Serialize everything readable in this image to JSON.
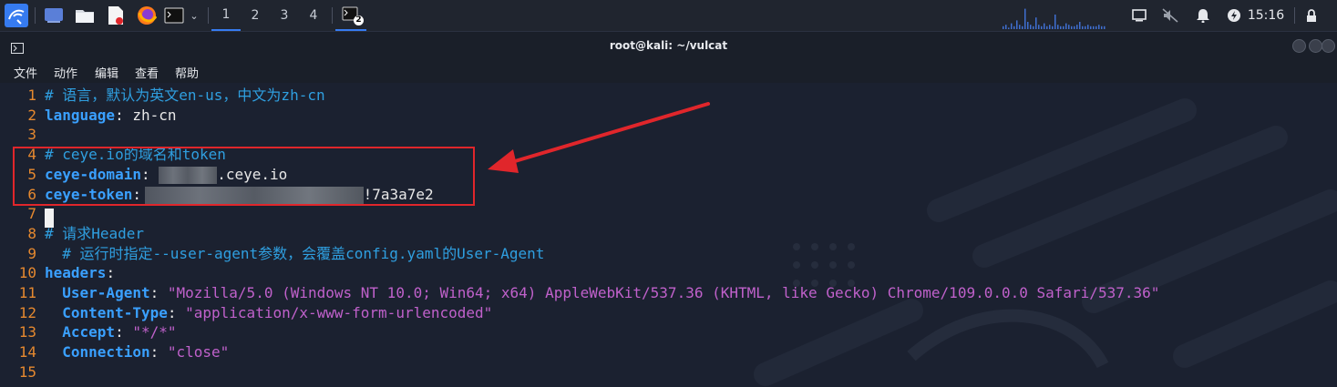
{
  "taskbar": {
    "workspaces": [
      "1",
      "2",
      "3",
      "4"
    ],
    "active_workspace": "1",
    "terminal_badge": "2",
    "clock": "15:16"
  },
  "window": {
    "title": "root@kali: ~/vulcat"
  },
  "menu": [
    "文件",
    "动作",
    "编辑",
    "查看",
    "帮助"
  ],
  "editor": {
    "lines": [
      {
        "n": "1",
        "comment": "# 语言，默认为英文en-us，中文为zh-cn"
      },
      {
        "n": "2",
        "key": "language",
        "sep": ": ",
        "value": "zh-cn"
      },
      {
        "n": "3"
      },
      {
        "n": "4",
        "comment": "# ceye.io的域名和token"
      },
      {
        "n": "5",
        "key": "ceye-domain",
        "sep": ": ",
        "value": ".ceye.io"
      },
      {
        "n": "6",
        "key": "ceye-token",
        "sep": ": ",
        "value": "!7a3a7e2"
      },
      {
        "n": "7"
      },
      {
        "n": "8",
        "comment": "# 请求Header"
      },
      {
        "n": "9",
        "comment": "  # 运行时指定--user-agent参数，会覆盖config.yaml的User-Agent"
      },
      {
        "n": "10",
        "key": "headers",
        "sep": ":"
      },
      {
        "n": "11",
        "indent": "  ",
        "key": "User-Agent",
        "sep": ": ",
        "string": "\"Mozilla/5.0 (Windows NT 10.0; Win64; x64) AppleWebKit/537.36 (KHTML, like Gecko) Chrome/109.0.0.0 Safari/537.36\""
      },
      {
        "n": "12",
        "indent": "  ",
        "key": "Content-Type",
        "sep": ": ",
        "string": "\"application/x-www-form-urlencoded\""
      },
      {
        "n": "13",
        "indent": "  ",
        "key": "Accept",
        "sep": ": ",
        "string": "\"*/*\""
      },
      {
        "n": "14",
        "indent": "  ",
        "key": "Connection",
        "sep": ": ",
        "string": "\"close\""
      },
      {
        "n": "15"
      }
    ]
  },
  "colors": {
    "accent": "#367bf0",
    "line_number": "#e6892f",
    "comment": "#2f9fe0",
    "key": "#3aa0ff",
    "string": "#c061cb",
    "annotation": "#e0262b"
  }
}
